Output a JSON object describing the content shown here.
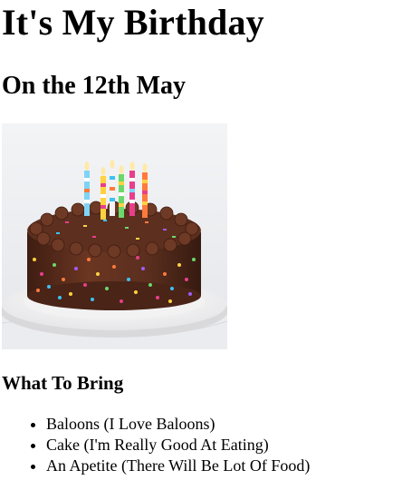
{
  "header": {
    "title": "It's My Birthday",
    "subtitle": "On the 12th May"
  },
  "image": {
    "alt": "Birthday cake",
    "icon": "birthday-cake-photo",
    "colors": {
      "background": "#eef0f2",
      "plate": "#f7f7f7",
      "frosting": "#5a2e1e",
      "frosting_dark": "#3e1d12"
    }
  },
  "bring": {
    "heading": "What To Bring",
    "items": [
      "Baloons (I Love Baloons)",
      "Cake (I'm Really Good At Eating)",
      "An Apetite (There Will Be Lot Of Food)"
    ]
  }
}
